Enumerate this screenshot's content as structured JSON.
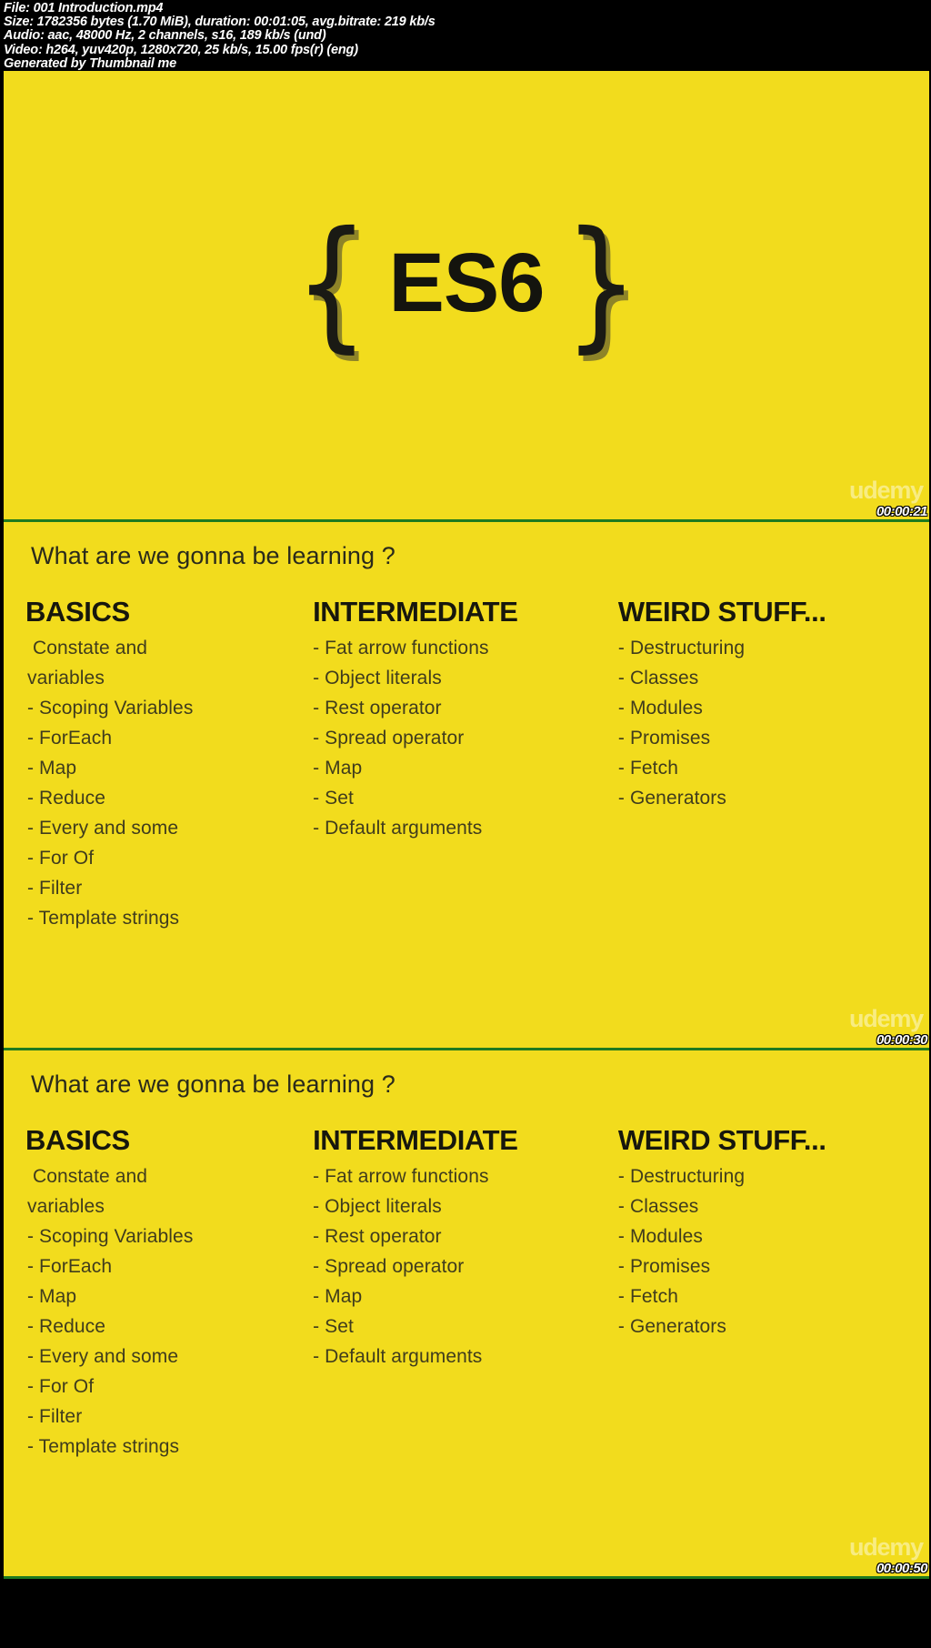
{
  "meta_header": {
    "lines": [
      "File: 001 Introduction.mp4",
      "Size: 1782356 bytes (1.70 MiB), duration: 00:01:05, avg.bitrate: 219 kb/s",
      "Audio: aac, 48000 Hz, 2 channels, s16, 189 kb/s (und)",
      "Video: h264, yuv420p, 1280x720, 25 kb/s, 15.00 fps(r) (eng)",
      "Generated by Thumbnail me"
    ]
  },
  "colors": {
    "slide_background": "#f2dc1d",
    "page_background": "#000000",
    "separator_green": "#1f7a1f",
    "heading_text": "#17170d",
    "body_text": "#403c1d",
    "watermark": "#ffffff"
  },
  "watermark": {
    "label": "udemy"
  },
  "thumbnails": [
    {
      "kind": "logo",
      "timecode": "00:00:21",
      "logo": {
        "left_brace": "{",
        "word": "ES6",
        "right_brace": "}"
      }
    },
    {
      "kind": "slide",
      "timecode": "00:00:30",
      "title": "What are we gonna be learning ?",
      "columns": [
        {
          "heading": "BASICS",
          "items": [
            " Constate and",
            "variables",
            "- Scoping Variables",
            "- ForEach",
            "- Map",
            "- Reduce",
            "- Every and some",
            "- For Of",
            "- Filter",
            "- Template strings"
          ]
        },
        {
          "heading": "INTERMEDIATE",
          "items": [
            "- Fat arrow functions",
            "- Object literals",
            "- Rest operator",
            "- Spread operator",
            "- Map",
            "- Set",
            "- Default arguments"
          ]
        },
        {
          "heading": "WEIRD STUFF...",
          "items": [
            "- Destructuring",
            "- Classes",
            "- Modules",
            "- Promises",
            "- Fetch",
            "- Generators"
          ]
        }
      ]
    },
    {
      "kind": "slide",
      "timecode": "00:00:50",
      "title": "What are we gonna be learning ?",
      "columns": [
        {
          "heading": "BASICS",
          "items": [
            " Constate and",
            "variables",
            "- Scoping Variables",
            "- ForEach",
            "- Map",
            "- Reduce",
            "- Every and some",
            "- For Of",
            "- Filter",
            "- Template strings"
          ]
        },
        {
          "heading": "INTERMEDIATE",
          "items": [
            "- Fat arrow functions",
            "- Object literals",
            "- Rest operator",
            "- Spread operator",
            "- Map",
            "- Set",
            "- Default arguments"
          ]
        },
        {
          "heading": "WEIRD STUFF...",
          "items": [
            "- Destructuring",
            "- Classes",
            "- Modules",
            "- Promises",
            "- Fetch",
            "- Generators"
          ]
        }
      ]
    }
  ]
}
